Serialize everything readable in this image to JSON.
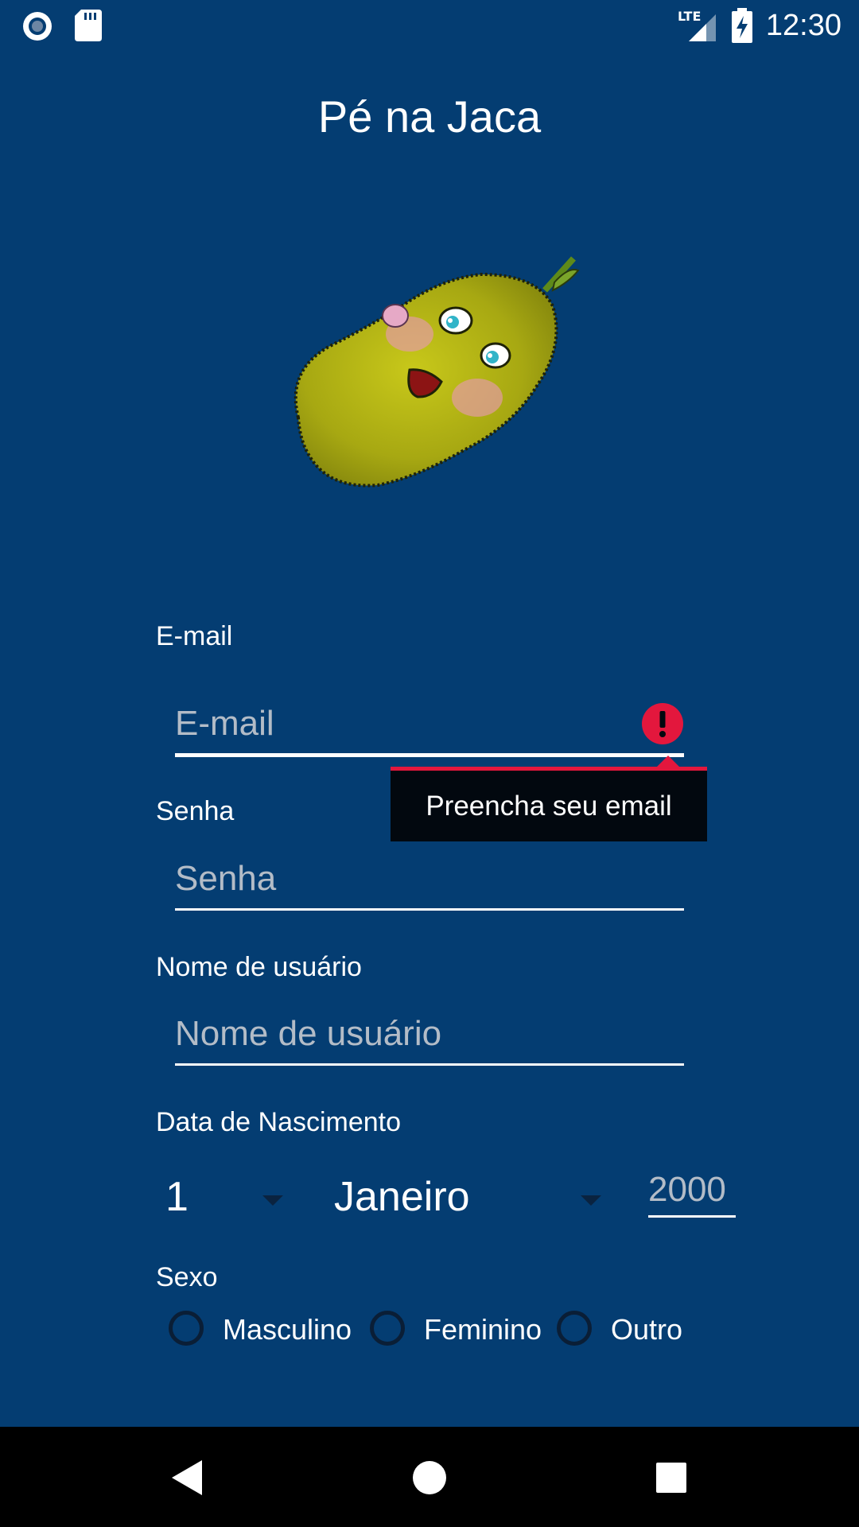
{
  "status_bar": {
    "time": "12:30",
    "network": "LTE"
  },
  "app": {
    "title": "Pé na Jaca"
  },
  "form": {
    "email": {
      "label": "E-mail",
      "placeholder": "E-mail",
      "error_message": "Preencha seu email"
    },
    "password": {
      "label": "Senha",
      "placeholder": "Senha"
    },
    "username": {
      "label": "Nome de usuário",
      "placeholder": "Nome de usuário"
    },
    "birthdate": {
      "label": "Data de Nascimento",
      "day": "1",
      "month": "Janeiro",
      "year_placeholder": "2000"
    },
    "sex": {
      "label": "Sexo",
      "options": [
        "Masculino",
        "Feminino",
        "Outro"
      ]
    }
  },
  "colors": {
    "background": "#043D72",
    "error": "#E3173D",
    "tooltip_bg": "#02080F",
    "placeholder": "#B3BCC7"
  }
}
